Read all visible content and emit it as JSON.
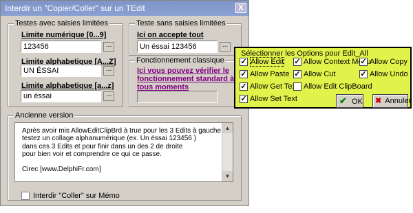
{
  "window": {
    "title": "Interdir un \"Copier/Coller\" sur un TEdit",
    "close_glyph": "X"
  },
  "group_left": {
    "label": "Testes avec saisies limitées",
    "fields": [
      {
        "label": "Limite numérique [0...9]",
        "value": "123456",
        "button": "..."
      },
      {
        "label": "Limite alphabetique [A...Z]",
        "value": "UN ÉSSAI",
        "button": "..."
      },
      {
        "label": "Limite alphabetique [a...z]",
        "value": "un éssai",
        "button": "..."
      }
    ]
  },
  "group_right": {
    "label": "Teste sans saisies limitées",
    "field_label": "Ici on accepte tout",
    "field_value": "Un éssai 123456",
    "button": "..."
  },
  "group_classic": {
    "label": "Fonctionnement classique",
    "link_text": "Ici vous pouvez vérifier le fonctionnement standard à tous moments",
    "field_value": ""
  },
  "group_old": {
    "label": "Ancienne version",
    "memo_lines": [
      "Après avoir mis AllowEditClipBrd à true pour les 3 Edits à gauche",
      "testez un collage alphanumérique (ex. Un éssai 123456 )",
      "dans ces 3 Edits et pour finir dans un des 2 de droite",
      "pour bien voir et comprendre ce qui ce passe.",
      "",
      "Cirec [www.DelphiFr.com]"
    ],
    "checkbox_label": "Interdir \"Coller\" sur Mémo",
    "checkbox_checked": false
  },
  "popup": {
    "title": "Sélectionner les Options pour Edit_All",
    "options": [
      {
        "label": "Allow Edit",
        "checked": true
      },
      {
        "label": "Allow Context Menu",
        "checked": true
      },
      {
        "label": "Allow Copy",
        "checked": true
      },
      {
        "label": "Allow Paste",
        "checked": true
      },
      {
        "label": "Allow Cut",
        "checked": true
      },
      {
        "label": "Allow Undo",
        "checked": true
      },
      {
        "label": "Allow Get Text",
        "checked": true
      },
      {
        "label": "Allow Edit ClipBoard",
        "checked": false
      },
      {
        "label": "Allow Set Text",
        "checked": true
      }
    ],
    "ok_label": "OK",
    "cancel_label": "Annuler",
    "ok_icon": "✔",
    "cancel_icon": "✖"
  },
  "colors": {
    "titlebar": "#8aa0d2",
    "popup_bg": "#e1f34a",
    "link": "#800080",
    "ok_icon": "#008000",
    "cancel_icon": "#cc0000"
  }
}
